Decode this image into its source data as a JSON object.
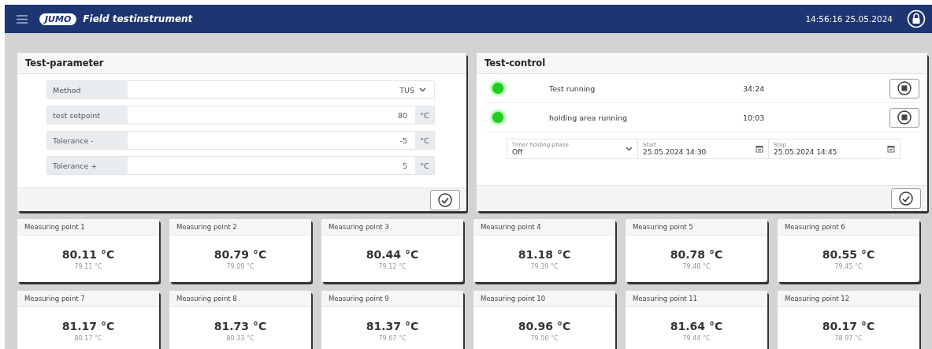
{
  "header": {
    "logo": "JUMO",
    "title": "Field testinstrument",
    "datetime": "14:56:16 25.05.2024"
  },
  "test_parameter": {
    "title": "Test-parameter",
    "fields": [
      {
        "kind": "select",
        "label": "Method",
        "value": "TUS"
      },
      {
        "kind": "number",
        "label": "test setpoint",
        "value": "80",
        "unit": "°C"
      },
      {
        "kind": "number",
        "label": "Tolerance -",
        "value": "-5",
        "unit": "°C"
      },
      {
        "kind": "number",
        "label": "Tolerance +",
        "value": "5",
        "unit": "°C"
      }
    ]
  },
  "test_control": {
    "title": "Test-control",
    "statuses": [
      {
        "label": "Test running",
        "time": "34:24",
        "running": true
      },
      {
        "label": "holding area running",
        "time": "10:03",
        "running": true
      }
    ],
    "inputs": [
      {
        "kind": "select",
        "label": "Timer holding-phase",
        "value": "Off"
      },
      {
        "kind": "date",
        "label": "Start",
        "value": "25.05.2024 14:30"
      },
      {
        "kind": "date",
        "label": "Stop",
        "value": "25.05.2024 14:45"
      }
    ]
  },
  "measuring_points": [
    {
      "name": "Measuring point 1",
      "value": "80.11 °C",
      "secondary": "79.11 °C"
    },
    {
      "name": "Measuring point 2",
      "value": "80.79 °C",
      "secondary": "79.09 °C"
    },
    {
      "name": "Measuring point 3",
      "value": "80.44 °C",
      "secondary": "79.12 °C"
    },
    {
      "name": "Measuring point 4",
      "value": "81.18 °C",
      "secondary": "79.39 °C"
    },
    {
      "name": "Measuring point 5",
      "value": "80.78 °C",
      "secondary": "79.48 °C"
    },
    {
      "name": "Measuring point 6",
      "value": "80.55 °C",
      "secondary": "79.45 °C"
    },
    {
      "name": "Measuring point 7",
      "value": "81.17 °C",
      "secondary": "80.17 °C"
    },
    {
      "name": "Measuring point 8",
      "value": "81.73 °C",
      "secondary": "80.33 °C"
    },
    {
      "name": "Measuring point 9",
      "value": "81.37 °C",
      "secondary": "79.67 °C"
    },
    {
      "name": "Measuring point 10",
      "value": "80.96 °C",
      "secondary": "79.56 °C"
    },
    {
      "name": "Measuring point 11",
      "value": "81.64 °C",
      "secondary": "79.44 °C"
    },
    {
      "name": "Measuring point 12",
      "value": "80.17 °C",
      "secondary": "78.97 °C"
    }
  ]
}
